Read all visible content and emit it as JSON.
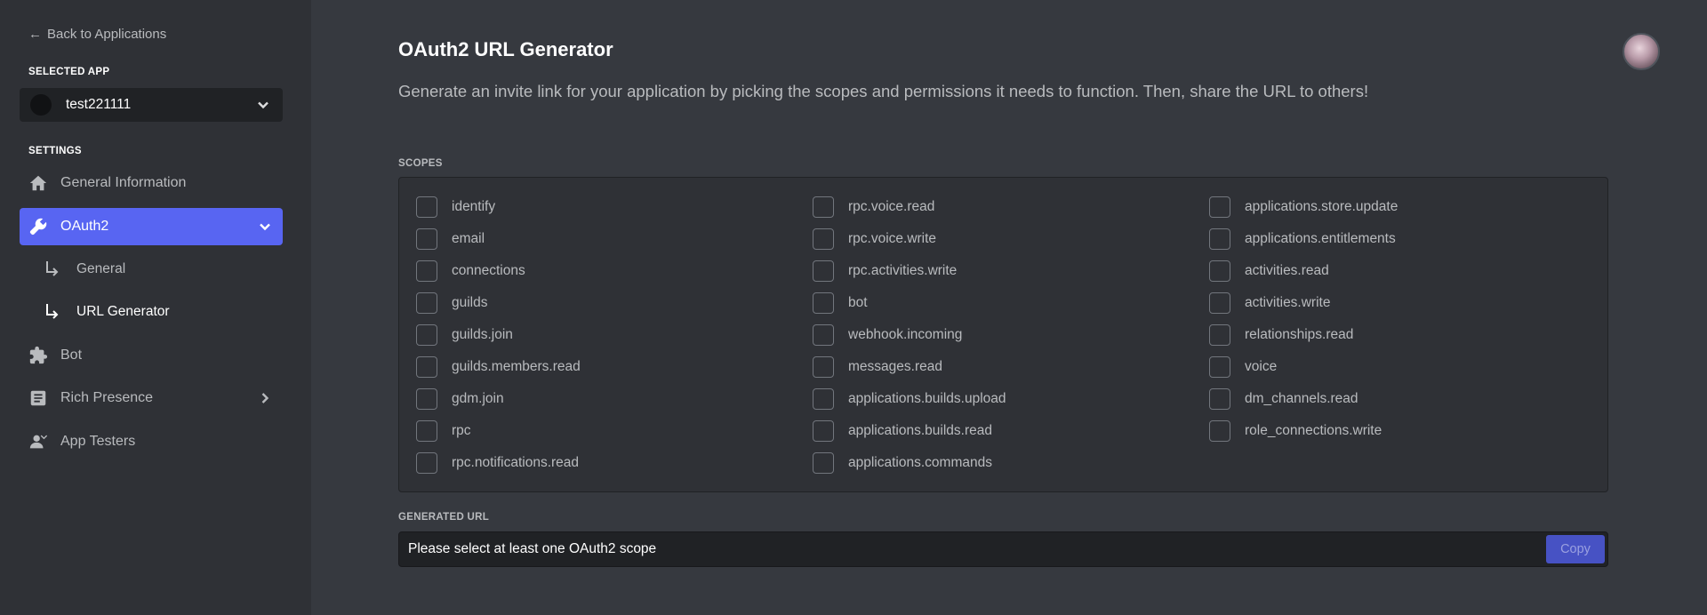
{
  "sidebar": {
    "back_label": "Back to Applications",
    "selected_app_label": "SELECTED APP",
    "app_name": "test221111",
    "settings_label": "SETTINGS",
    "items": [
      {
        "label": "General Information",
        "icon": "home-icon"
      },
      {
        "label": "OAuth2",
        "icon": "wrench-icon",
        "active": true
      },
      {
        "label": "Bot",
        "icon": "puzzle-icon"
      },
      {
        "label": "Rich Presence",
        "icon": "document-icon"
      },
      {
        "label": "App Testers",
        "icon": "person-icon"
      }
    ],
    "sub_items": [
      {
        "label": "General"
      },
      {
        "label": "URL Generator",
        "active": true
      }
    ]
  },
  "main": {
    "title": "OAuth2 URL Generator",
    "description": "Generate an invite link for your application by picking the scopes and permissions it needs to function. Then, share the URL to others!",
    "scopes_label": "SCOPES",
    "scopes_columns": [
      [
        "identify",
        "email",
        "connections",
        "guilds",
        "guilds.join",
        "guilds.members.read",
        "gdm.join",
        "rpc",
        "rpc.notifications.read"
      ],
      [
        "rpc.voice.read",
        "rpc.voice.write",
        "rpc.activities.write",
        "bot",
        "webhook.incoming",
        "messages.read",
        "applications.builds.upload",
        "applications.builds.read",
        "applications.commands"
      ],
      [
        "applications.store.update",
        "applications.entitlements",
        "activities.read",
        "activities.write",
        "relationships.read",
        "voice",
        "dm_channels.read",
        "role_connections.write"
      ]
    ],
    "generated_url_label": "GENERATED URL",
    "generated_url_value": "Please select at least one OAuth2 scope",
    "copy_label": "Copy"
  },
  "colors": {
    "accent": "#5865f2",
    "background": "#36393f",
    "sidebar": "#2f3136"
  }
}
